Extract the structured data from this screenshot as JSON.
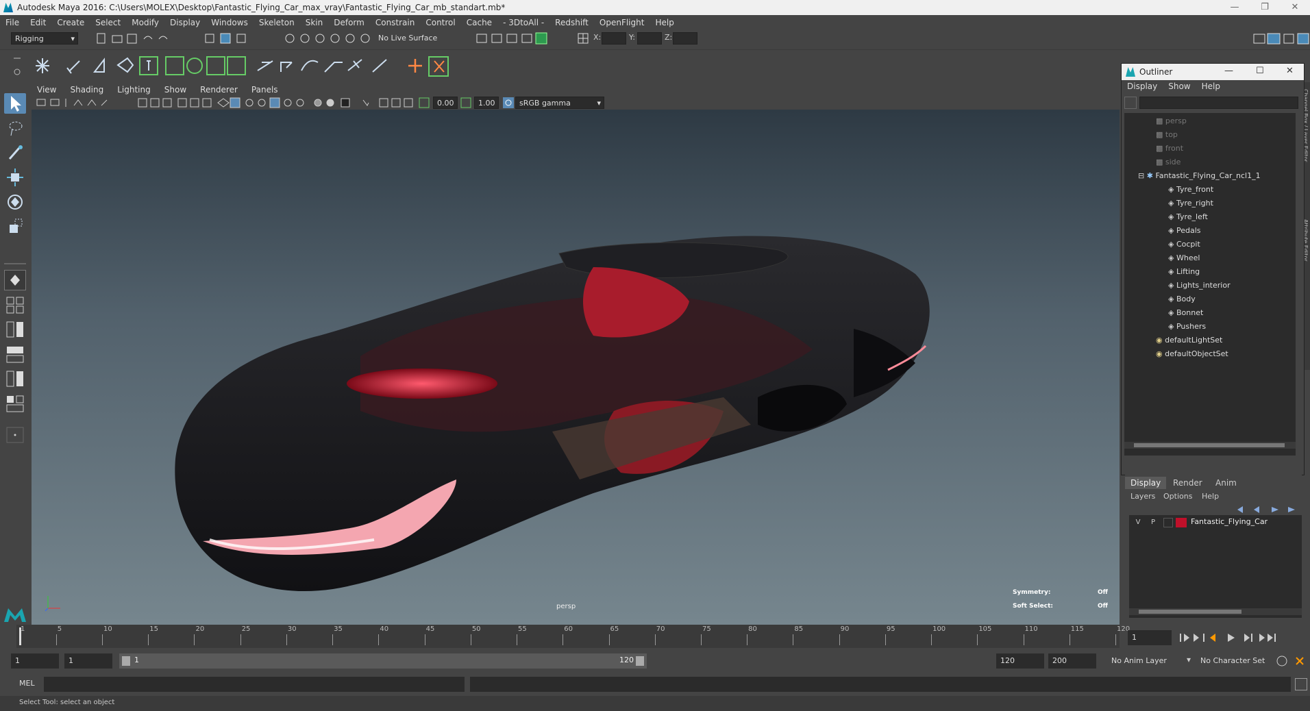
{
  "window": {
    "title": "Autodesk Maya 2016: C:\\Users\\MOLEX\\Desktop\\Fantastic_Flying_Car_max_vray\\Fantastic_Flying_Car_mb_standart.mb*"
  },
  "menubar": [
    "File",
    "Edit",
    "Create",
    "Select",
    "Modify",
    "Display",
    "Windows",
    "Skeleton",
    "Skin",
    "Deform",
    "Constrain",
    "Control",
    "Cache",
    "- 3DtoAll -",
    "Redshift",
    "OpenFlight",
    "Help"
  ],
  "statusline": {
    "menuset": "Rigging",
    "live_surface": "No Live Surface",
    "x_label": "X:",
    "y_label": "Y:",
    "z_label": "Z:"
  },
  "panel_menu": [
    "View",
    "Shading",
    "Lighting",
    "Show",
    "Renderer",
    "Panels"
  ],
  "panel_toolbar": {
    "exposure": "0.00",
    "gamma": "1.00",
    "colorspace": "sRGB gamma"
  },
  "viewport": {
    "camera": "persp",
    "symmetry_label": "Symmetry:",
    "symmetry_value": "Off",
    "soft_select_label": "Soft Select:",
    "soft_select_value": "Off"
  },
  "outliner": {
    "title": "Outliner",
    "menu": [
      "Display",
      "Show",
      "Help"
    ],
    "items": [
      {
        "label": "persp",
        "type": "camera",
        "dim": true
      },
      {
        "label": "top",
        "type": "camera",
        "dim": true
      },
      {
        "label": "front",
        "type": "camera",
        "dim": true
      },
      {
        "label": "side",
        "type": "camera",
        "dim": true
      },
      {
        "label": "Fantastic_Flying_Car_ncl1_1",
        "type": "group",
        "dim": false
      },
      {
        "label": "Tyre_front",
        "type": "mesh",
        "dim": false
      },
      {
        "label": "Tyre_right",
        "type": "mesh",
        "dim": false
      },
      {
        "label": "Tyre_left",
        "type": "mesh",
        "dim": false
      },
      {
        "label": "Pedals",
        "type": "mesh",
        "dim": false
      },
      {
        "label": "Cocpit",
        "type": "mesh",
        "dim": false
      },
      {
        "label": "Wheel",
        "type": "mesh",
        "dim": false
      },
      {
        "label": "Lifting",
        "type": "mesh",
        "dim": false
      },
      {
        "label": "Lights_interior",
        "type": "mesh",
        "dim": false
      },
      {
        "label": "Body",
        "type": "mesh",
        "dim": false
      },
      {
        "label": "Bonnet",
        "type": "mesh",
        "dim": false
      },
      {
        "label": "Pushers",
        "type": "mesh",
        "dim": false
      },
      {
        "label": "defaultLightSet",
        "type": "set",
        "dim": false
      },
      {
        "label": "defaultObjectSet",
        "type": "set",
        "dim": false
      }
    ]
  },
  "side_tabs": {
    "channel_box": "Channel Box / Layer Editor",
    "attribute_editor": "Attribute Editor"
  },
  "layer_editor": {
    "tabs": [
      "Display",
      "Render",
      "Anim"
    ],
    "menu": [
      "Layers",
      "Options",
      "Help"
    ],
    "layer": {
      "v": "V",
      "p": "P",
      "name": "Fantastic_Flying_Car",
      "color": "#c0102a"
    }
  },
  "timeline": {
    "ticks": [
      "1",
      "5",
      "10",
      "15",
      "20",
      "25",
      "30",
      "35",
      "40",
      "45",
      "50",
      "55",
      "60",
      "65",
      "70",
      "75",
      "80",
      "85",
      "90",
      "95",
      "100",
      "105",
      "110",
      "115",
      "120"
    ],
    "current_frame": "1"
  },
  "range": {
    "start": "1",
    "playback_start": "1",
    "slider_start": "1",
    "slider_end": "120",
    "playback_end": "120",
    "end": "200",
    "anim_layer": "No Anim Layer",
    "character_set": "No Character Set"
  },
  "command": {
    "language": "MEL"
  },
  "help": {
    "text": "Select Tool: select an object"
  }
}
